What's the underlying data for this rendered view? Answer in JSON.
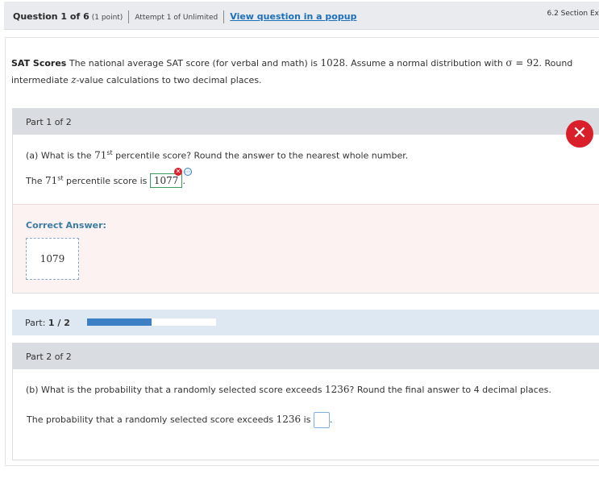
{
  "topbar": {
    "question": "Question 1 of 6",
    "points": "(1 point)",
    "attempt": "Attempt 1 of Unlimited",
    "popup_link": "View question in a popup",
    "section": "6.2 Section Ex"
  },
  "intro": {
    "title": "SAT Scores",
    "text_1": " The national average SAT score (for verbal and math) is ",
    "mean": "1028",
    "text_2": ". Assume a normal distribution with ",
    "sigma": "σ = 92",
    "text_3": ". Round intermediate ",
    "z": "z",
    "text_4": "-value calculations to two decimal places."
  },
  "part1": {
    "header": "Part 1 of 2",
    "question_prefix": "(a) What is the ",
    "percentile": "71",
    "ordinal": "st",
    "question_suffix": " percentile score? Round the answer to the nearest whole number.",
    "line_prefix": "The ",
    "line_middle": " percentile score is ",
    "answer": "1077",
    "line_end": ".",
    "correct_label": "Correct Answer:",
    "correct_value": "1079"
  },
  "progress": {
    "label": "Part: ",
    "value": "1 / 2",
    "fraction": 0.5
  },
  "part2": {
    "header": "Part 2 of 2",
    "question_prefix": "(b) What is the probability that a randomly selected score exceeds ",
    "score": "1236",
    "question_suffix": "? Round the final answer to 4 decimal places.",
    "line_prefix": "The probability that a randomly selected score exceeds ",
    "line_is": " is ",
    "line_end": "."
  },
  "icons": {
    "incorrect": "close-icon",
    "mini_incorrect": "x-icon",
    "more": "more-icon"
  },
  "colors": {
    "incorrect": "#d9202a",
    "link": "#1d6fb8",
    "progress": "#3d7fc4",
    "correct_label": "#3a7ca5"
  }
}
